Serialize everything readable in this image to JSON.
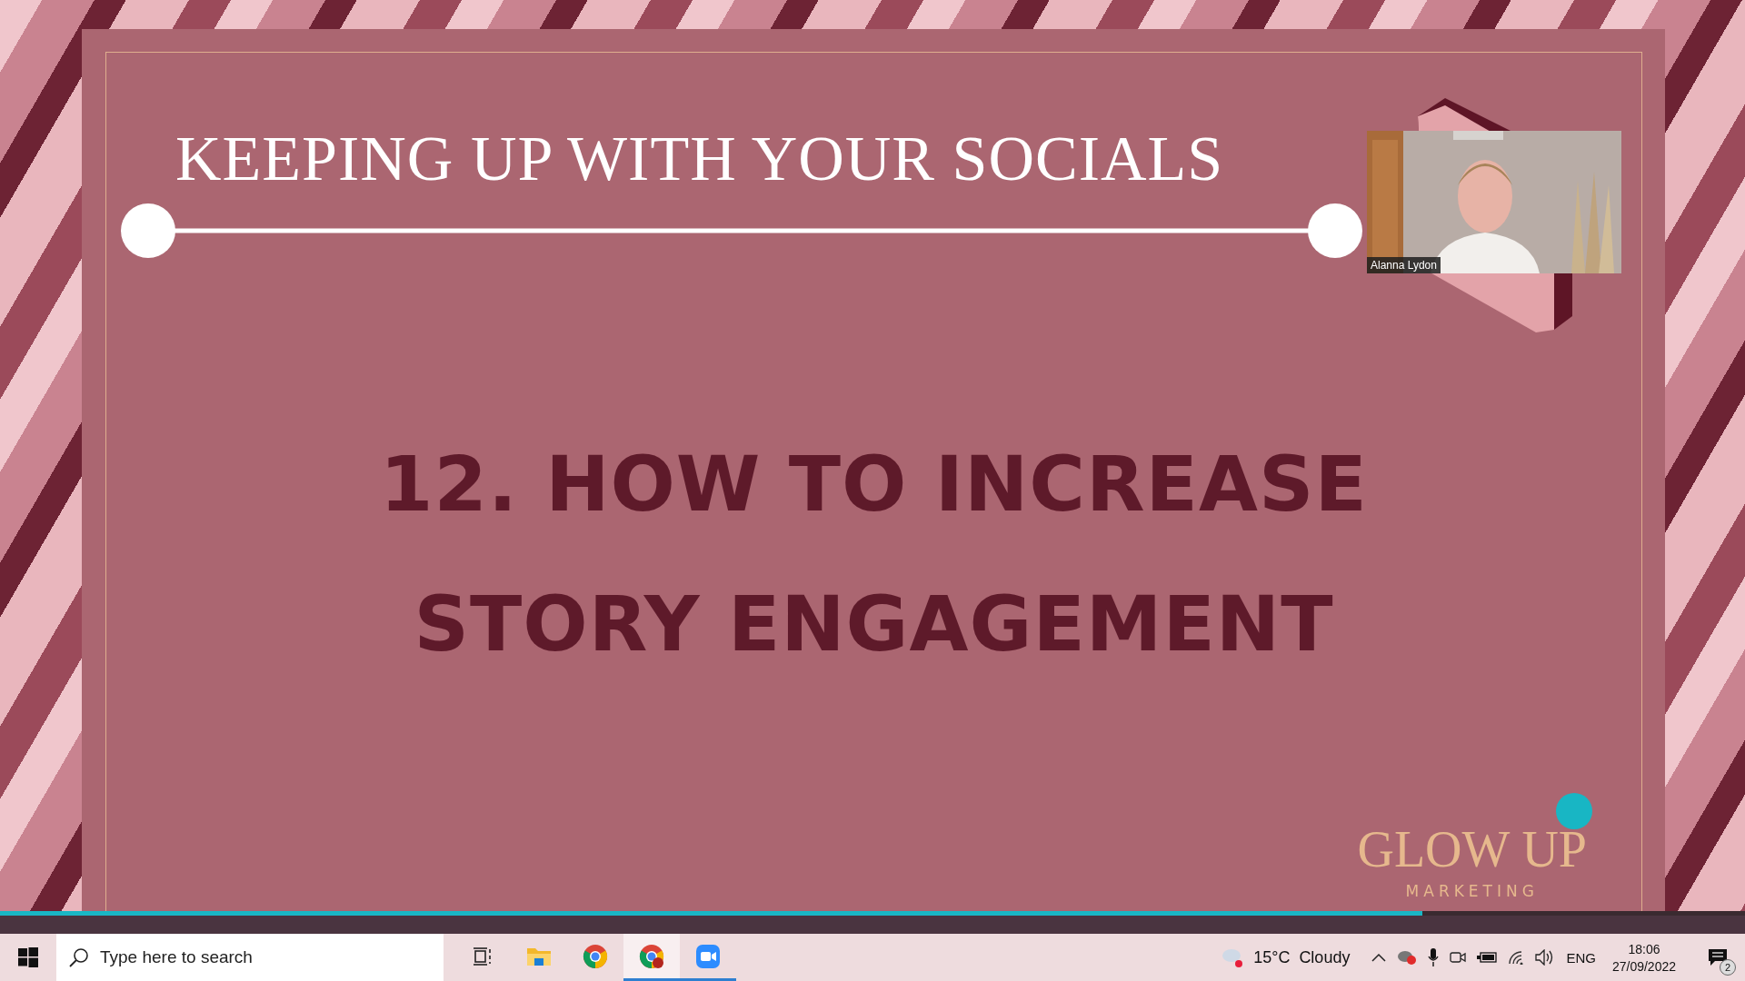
{
  "slide": {
    "title": "KEEPING UP WITH YOUR SOCIALS",
    "heading_lines": [
      "12. HOW TO INCREASE",
      "STORY ENGAGEMENT"
    ],
    "logo": {
      "name": "GLOW UP",
      "tagline": "MARKETING"
    }
  },
  "webcam": {
    "participant_name": "Alanna Lydon"
  },
  "playback": {
    "level": 0.815
  },
  "taskbar": {
    "search": {
      "placeholder": "Type here to search"
    },
    "apps": [
      {
        "kind": "task-view",
        "running": false,
        "selected": false
      },
      {
        "kind": "file-explorer",
        "running": false,
        "selected": false
      },
      {
        "kind": "chrome",
        "running": false,
        "selected": false
      },
      {
        "kind": "chrome-profile",
        "running": true,
        "selected": true
      },
      {
        "kind": "zoom",
        "running": true,
        "selected": false
      }
    ],
    "weather": {
      "temperature": "15°C",
      "condition": "Cloudy"
    },
    "language": "ENG",
    "time": "18:06",
    "date": "27/09/2022",
    "notification_count": "2"
  }
}
